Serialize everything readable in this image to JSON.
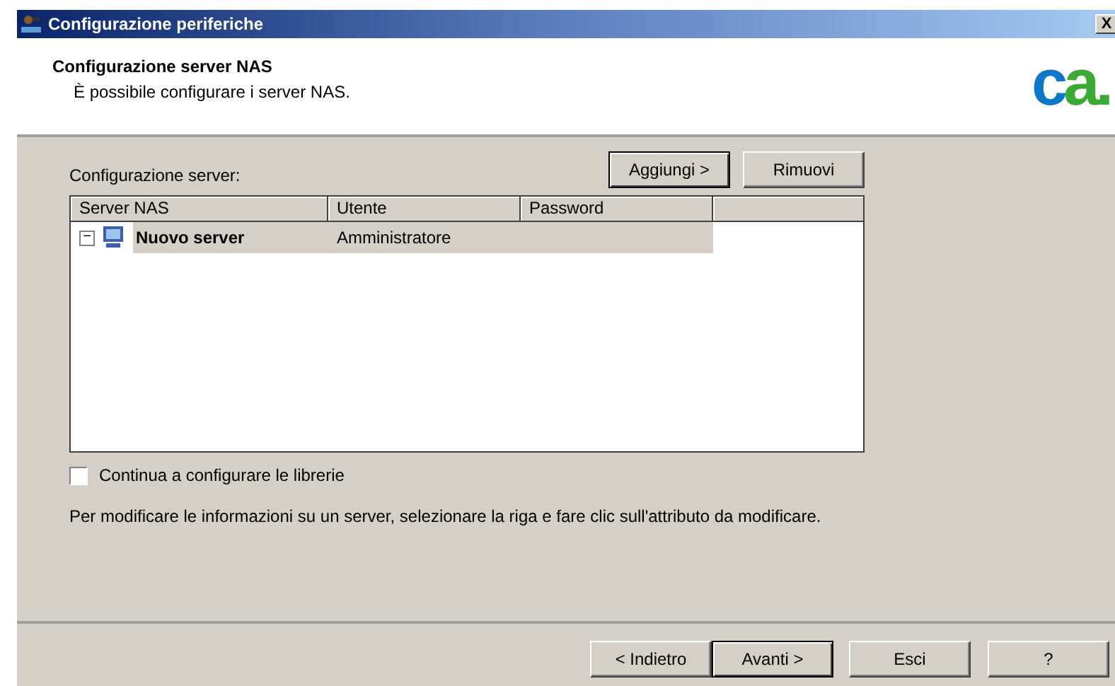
{
  "window": {
    "title": "Configurazione periferiche",
    "close": "X"
  },
  "header": {
    "title": "Configurazione server NAS",
    "subtitle": "È possibile configurare i server NAS.",
    "logo": [
      {
        "text": "c",
        "color": "#0b78c8"
      },
      {
        "text": "a.",
        "color": "#3aaa35"
      }
    ]
  },
  "server_list": {
    "label": "Configurazione server:",
    "buttons": [
      {
        "label": "Aggiungi >",
        "default": true
      },
      {
        "label": "Rimuovi",
        "default": false
      }
    ],
    "columns": [
      "Server NAS",
      "Utente",
      "Password"
    ],
    "rows": [
      {
        "expander": "−",
        "name": "Nuovo server",
        "user": "Amministratore",
        "password": "",
        "selected": true
      }
    ]
  },
  "checkbox": {
    "label": "Continua a configurare le librerie",
    "checked": false
  },
  "hint": "Per modificare le informazioni su un server, selezionare la riga e fare clic sull'attributo da modificare.",
  "footer_buttons": [
    {
      "label": "< Indietro",
      "default": false
    },
    {
      "label": "Avanti >",
      "default": true
    },
    {
      "label": "Esci",
      "default": false
    },
    {
      "label": "?",
      "default": false
    }
  ]
}
